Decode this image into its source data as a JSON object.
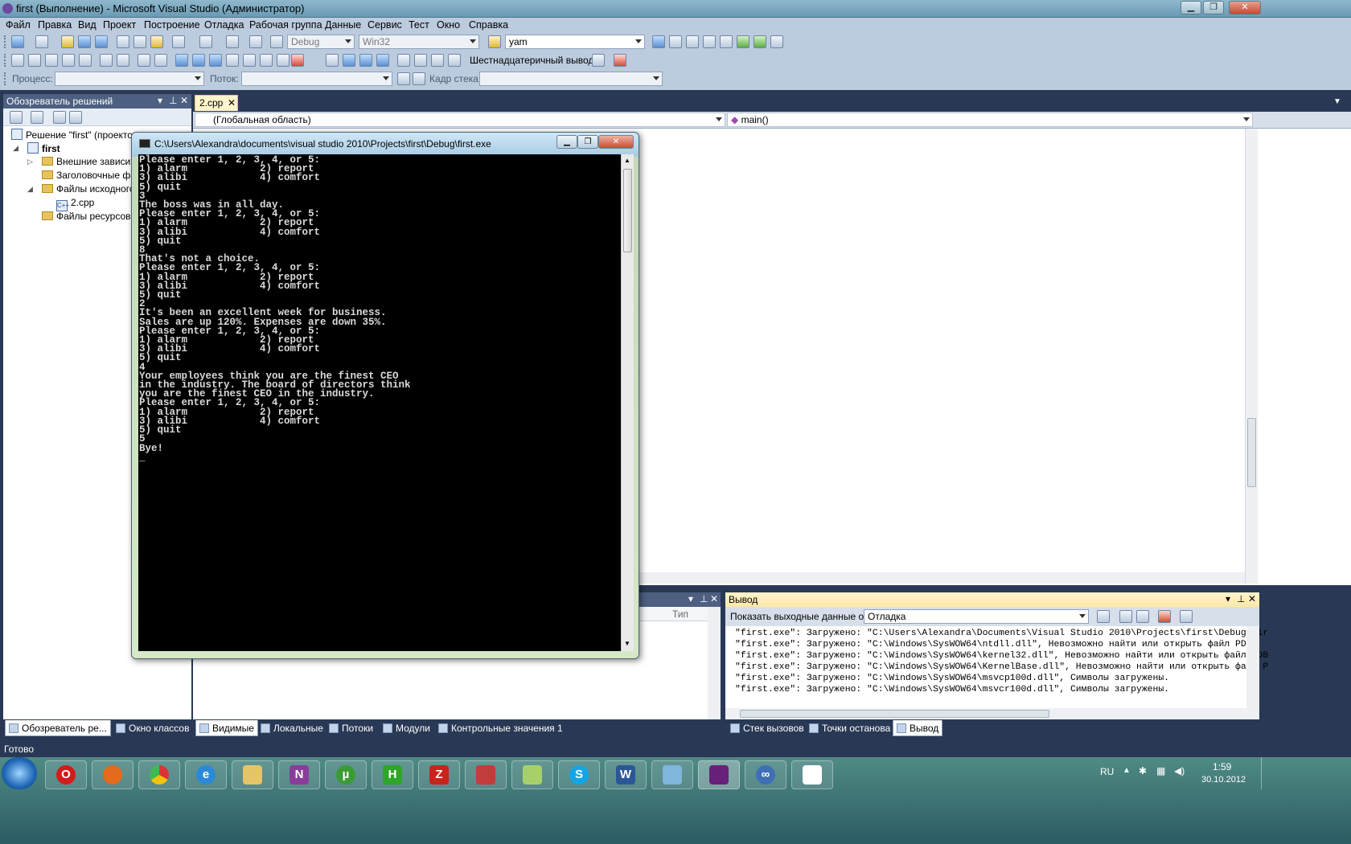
{
  "window": {
    "title": "first (Выполнение) - Microsoft Visual Studio (Администратор)"
  },
  "menu": [
    "Файл",
    "Правка",
    "Вид",
    "Проект",
    "Построение",
    "Отладка",
    "Рабочая группа",
    "Данные",
    "Сервис",
    "Тест",
    "Окно",
    "Справка"
  ],
  "toolbar": {
    "config": "Debug",
    "platform": "Win32",
    "find_value": "yam",
    "hex_label": "Шестнадцатеричный вывод",
    "process_label": "Процесс:",
    "thread_label": "Поток:",
    "frame_label": "Кадр стека:"
  },
  "solution_explorer": {
    "title": "Обозреватель решений",
    "items": [
      {
        "label": "Решение \"first\" (проекто"
      },
      {
        "label": "first"
      },
      {
        "label": "Внешние зависим"
      },
      {
        "label": "Заголовочные фа"
      },
      {
        "label": "Файлы исходного"
      },
      {
        "label": "2.cpp"
      },
      {
        "label": "Файлы ресурсов"
      }
    ]
  },
  "editor": {
    "tab": "2.cpp",
    "scope": "(Глобальная область)",
    "member": "main()"
  },
  "console": {
    "title": "C:\\Users\\Alexandra\\documents\\visual studio 2010\\Projects\\first\\Debug\\first.exe",
    "text": "Please enter 1, 2, 3, 4, or 5:\n1) alarm            2) report\n3) alibi            4) comfort\n5) quit\n3\nThe boss was in all day.\nPlease enter 1, 2, 3, 4, or 5:\n1) alarm            2) report\n3) alibi            4) comfort\n5) quit\n8\nThat's not a choice.\nPlease enter 1, 2, 3, 4, or 5:\n1) alarm            2) report\n3) alibi            4) comfort\n5) quit\n2\nIt's been an excellent week for business.\nSales are up 120%. Expenses are down 35%.\nPlease enter 1, 2, 3, 4, or 5:\n1) alarm            2) report\n3) alibi            4) comfort\n5) quit\n4\nYour employees think you are the finest CEO\nin the industry. The board of directors think\nyou are the finest CEO in the industry.\nPlease enter 1, 2, 3, 4, or 5:\n1) alarm            2) report\n3) alibi            4) comfort\n5) quit\n5\nBye!\n_"
  },
  "left_bottom_panel": {
    "col_type": "Тип"
  },
  "output": {
    "title": "Вывод",
    "show_from_label": "Показать выходные данные от:",
    "source": "Отладка",
    "lines": [
      "\"first.exe\": Загружено: \"C:\\Users\\Alexandra\\Documents\\Visual Studio 2010\\Projects\\first\\Debug\\fir",
      "\"first.exe\": Загружено: \"C:\\Windows\\SysWOW64\\ntdll.dll\", Невозможно найти или открыть файл PDB",
      "\"first.exe\": Загружено: \"C:\\Windows\\SysWOW64\\kernel32.dll\", Невозможно найти или открыть файл PDB",
      "\"first.exe\": Загружено: \"C:\\Windows\\SysWOW64\\KernelBase.dll\", Невозможно найти или открыть файл P",
      "\"first.exe\": Загружено: \"C:\\Windows\\SysWOW64\\msvcp100d.dll\", Символы загружены.",
      "\"first.exe\": Загружено: \"C:\\Windows\\SysWOW64\\msvcr100d.dll\", Символы загружены."
    ]
  },
  "bottom_tabs_left": [
    "Обозреватель ре...",
    "Окно классов"
  ],
  "bottom_tabs_mid": [
    "Видимые",
    "Локальные",
    "Потоки",
    "Модули",
    "Контрольные значения 1"
  ],
  "bottom_tabs_right": [
    "Стек вызовов",
    "Точки останова",
    "Вывод"
  ],
  "status": "Готово",
  "taskbar": {
    "lang": "RU",
    "time": "1:59",
    "date": "30.10.2012",
    "apps": [
      "opera",
      "firefox",
      "chrome",
      "internet-explorer",
      "explorer",
      "onenote",
      "utorrent",
      "hiew",
      "filezilla",
      "app-red",
      "notepad-plus",
      "skype",
      "word",
      "app-blue",
      "visual-studio",
      "infinity",
      "app-window"
    ]
  }
}
